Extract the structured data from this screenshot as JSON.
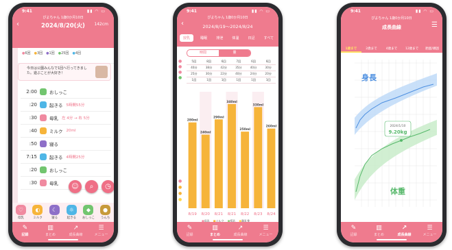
{
  "status_time": "9:41",
  "phone1": {
    "baby_label": "ぴよちゃん 1歳0か月10日",
    "date": "2024/8/20(火)",
    "height_value": "142cm",
    "summary": [
      "6回",
      "3回",
      "1回",
      "25回",
      "4回"
    ],
    "note": "今日は公園みんなで1回へ行ってきました。遊ぶことが大好き！",
    "entries": [
      {
        "time": "2:00",
        "label": "おしっこ",
        "sub": "",
        "color": "#72c56f"
      },
      {
        "time": ":20",
        "label": "起きる",
        "sub": "5時間55分",
        "color": "#4fb6e6"
      },
      {
        "time": ":30",
        "label": "母乳",
        "sub": "左 4分 → 右 5分",
        "color": "#f08aa0"
      },
      {
        "time": ":40",
        "label": "ミルク",
        "sub": "20ml",
        "color": "#f6b43a"
      },
      {
        "time": ":50",
        "label": "寝る",
        "sub": "",
        "color": "#8e6fc8"
      },
      {
        "time": "7:15",
        "label": "起きる",
        "sub": "4時間25分",
        "color": "#4fb6e6"
      },
      {
        "time": ":20",
        "label": "おしっこ",
        "sub": "",
        "color": "#72c56f"
      },
      {
        "time": ":30",
        "label": "母乳",
        "sub": "",
        "color": "#f08aa0"
      }
    ],
    "quick_buttons": [
      "母乳",
      "ミルク",
      "寝る",
      "起きる",
      "おしっこ",
      "うんち"
    ],
    "tabs": [
      "記録",
      "まとめ",
      "成長曲線",
      "メニュー"
    ]
  },
  "phone2": {
    "baby_label": "ぴよちゃん 1歳0か月10日",
    "range": "2024/8/19〜2024/8/24",
    "tabs": [
      "授乳",
      "睡眠",
      "排泄",
      "体温",
      "日記",
      "すべて"
    ],
    "segments": [
      "時間",
      "量"
    ],
    "grid_rows": [
      [
        "5回",
        "8回",
        "6回",
        "7回",
        "6回",
        "6回"
      ],
      [
        "40分",
        "38分",
        "42分",
        "35分",
        "40分",
        "30分"
      ],
      [
        "25分",
        "30分",
        "22分",
        "40分",
        "24分",
        "20分"
      ],
      [
        "1回",
        "1回",
        "1回",
        "1回",
        "1回",
        "1回"
      ]
    ],
    "legend": [
      "母乳",
      "ミルク",
      "搾乳",
      "離乳食"
    ],
    "tabs_bottom": [
      "記録",
      "まとめ",
      "成長曲線",
      "メニュー"
    ]
  },
  "phone3": {
    "baby_label": "ぴよちゃん 1歳0か月10日",
    "title": "成長曲線",
    "tabs": [
      "1歳まで",
      "2歳まで",
      "4歳まで",
      "12歳まで",
      "胎囲/頭囲"
    ],
    "height_label": "身長",
    "weight_label": "体重",
    "tooltip_date": "2024/1/10",
    "tooltip_value": "9.20kg",
    "tabs_bottom": [
      "記録",
      "まとめ",
      "成長曲線",
      "メニュー"
    ]
  },
  "chart_data": {
    "type": "bar",
    "categories": [
      "8/19",
      "8/20",
      "8/21",
      "8/21",
      "8/22",
      "8/23",
      "8/24"
    ],
    "series": [
      {
        "values": [
          280,
          240,
          290,
          340,
          250,
          330,
          260
        ]
      }
    ],
    "data_labels": [
      "280ml",
      "240ml",
      "290ml",
      "340ml",
      "250ml",
      "330ml",
      "260ml"
    ],
    "ylim": [
      0,
      380
    ],
    "grid": false
  }
}
